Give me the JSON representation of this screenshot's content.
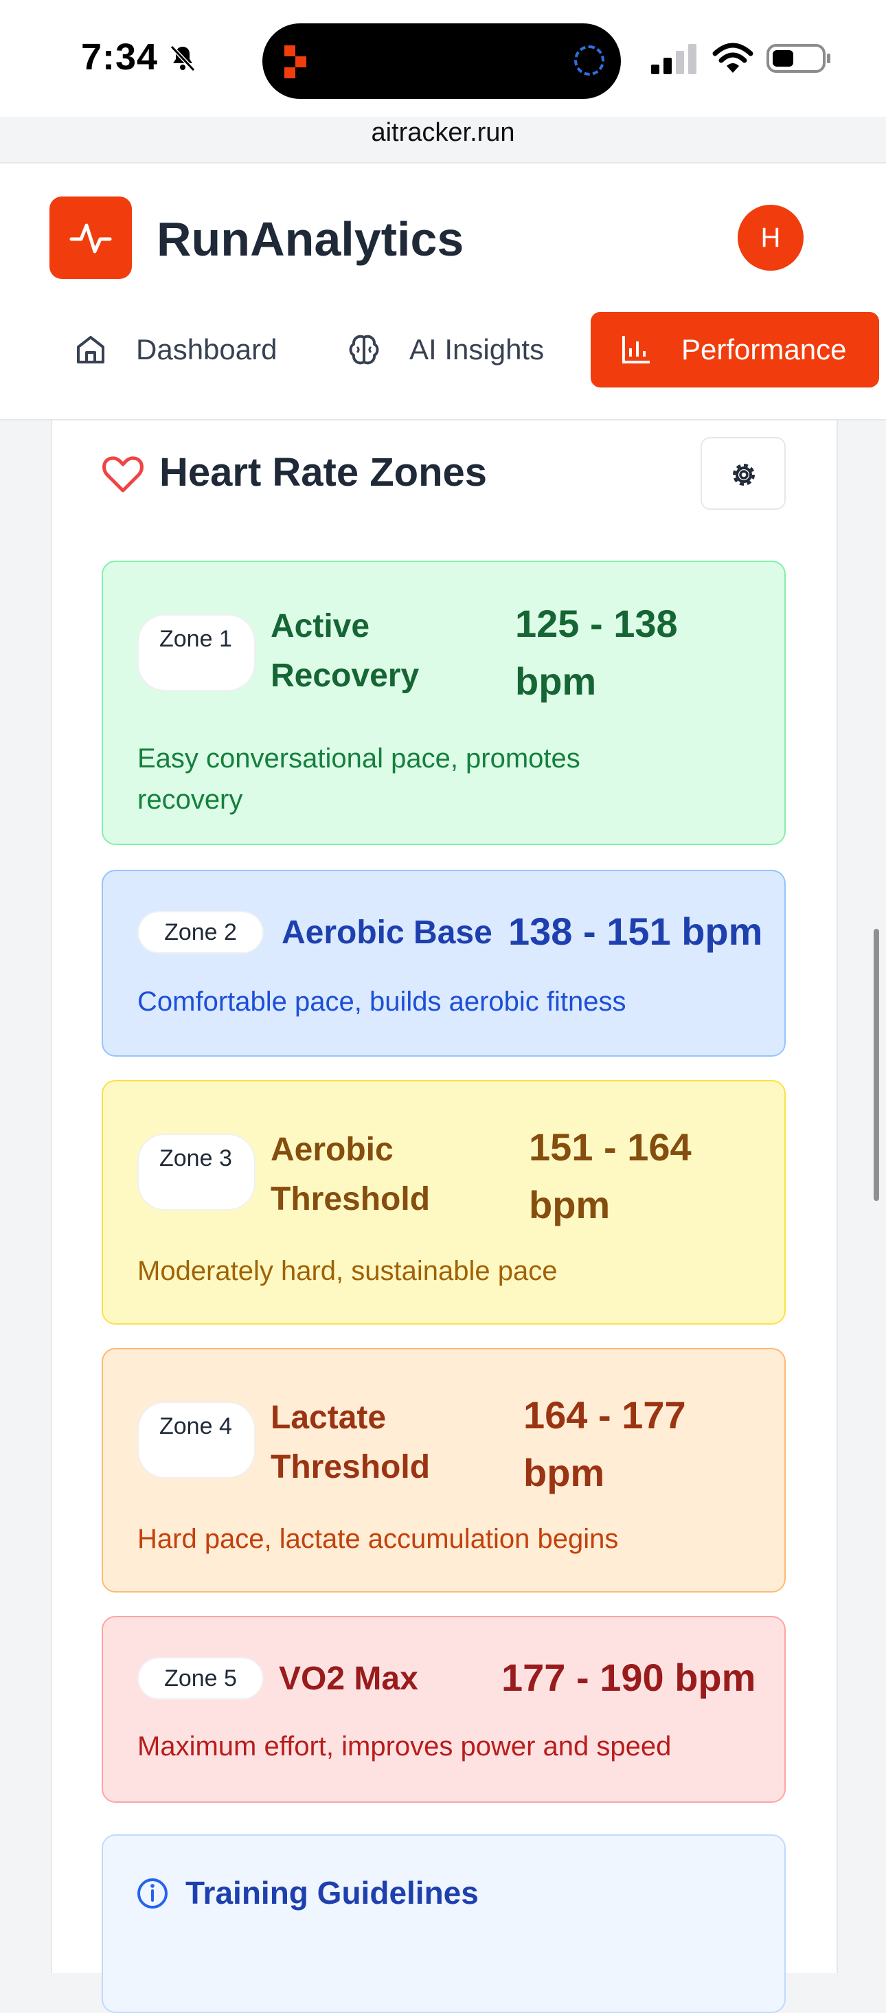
{
  "status_bar": {
    "time": "7:34",
    "url": "aitracker.run"
  },
  "app": {
    "title": "RunAnalytics",
    "avatar_initial": "H"
  },
  "nav": [
    {
      "label": "Dashboard",
      "icon": "home-icon"
    },
    {
      "label": "AI Insights",
      "icon": "brain-icon"
    },
    {
      "label": "Performance",
      "icon": "bar-chart-icon",
      "active": true
    }
  ],
  "heart_rate_zones": {
    "title": "Heart Rate Zones",
    "zones": [
      {
        "badge": "Zone 1",
        "name": "Active Recovery",
        "range": "125 - 138 bpm",
        "description": "Easy conversational pace, promotes recovery",
        "color": "#166534"
      },
      {
        "badge": "Zone 2",
        "name": "Aerobic Base",
        "range": "138 - 151 bpm",
        "description": "Comfortable pace, builds aerobic fitness",
        "color": "#1e40af"
      },
      {
        "badge": "Zone 3",
        "name": "Aerobic Threshold",
        "range": "151 - 164 bpm",
        "description": "Moderately hard, sustainable pace",
        "color": "#854d0e"
      },
      {
        "badge": "Zone 4",
        "name": "Lactate Threshold",
        "range": "164 - 177 bpm",
        "description": "Hard pace, lactate accumulation begins",
        "color": "#9a3412"
      },
      {
        "badge": "Zone 5",
        "name": "VO2 Max",
        "range": "177 - 190 bpm",
        "description": "Maximum effort, improves power and speed",
        "color": "#991b1b"
      }
    ],
    "guidelines_title": "Training Guidelines"
  },
  "colors": {
    "brand": "#f13d0d",
    "heart": "#ef4444"
  }
}
